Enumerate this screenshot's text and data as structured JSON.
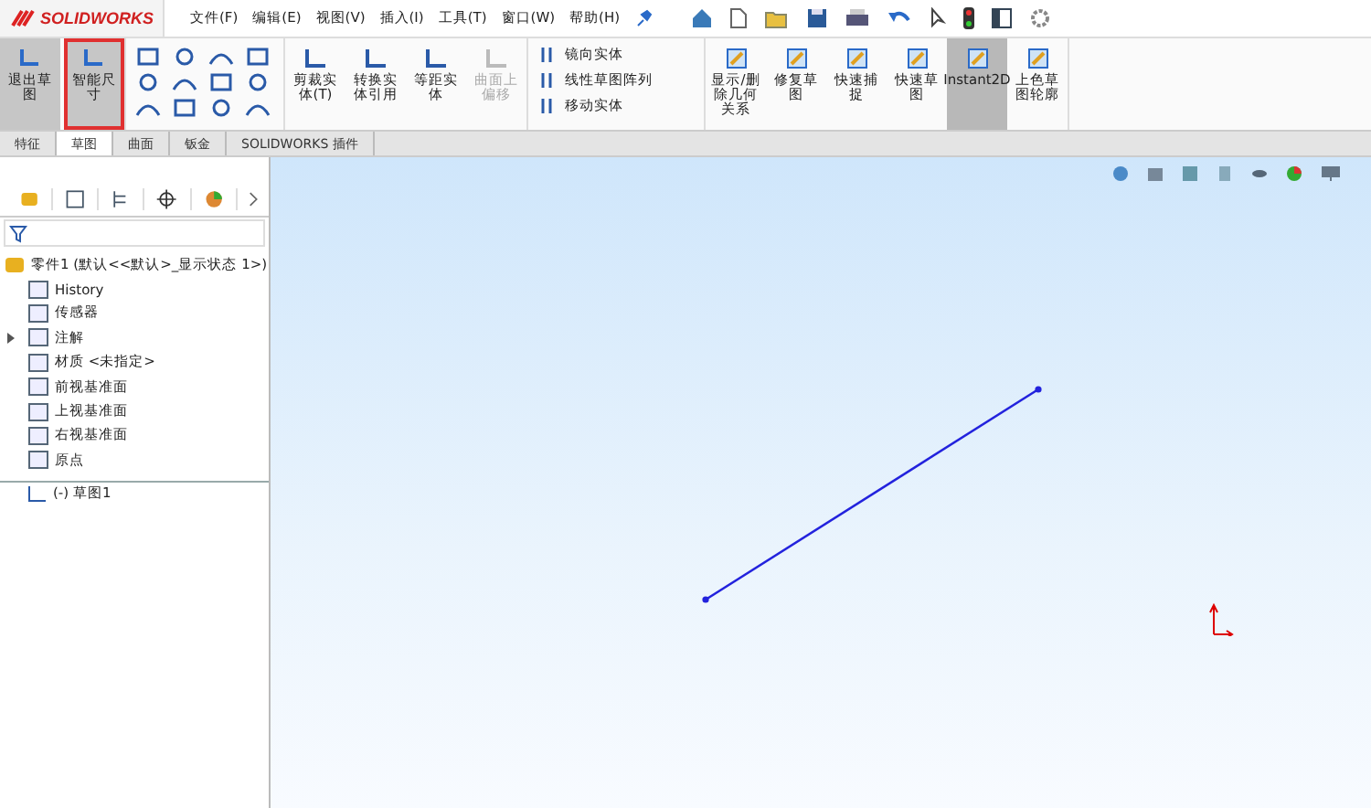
{
  "app": {
    "logo": "SOLIDWORKS"
  },
  "menu": [
    {
      "label": "文件(F)"
    },
    {
      "label": "编辑(E)"
    },
    {
      "label": "视图(V)"
    },
    {
      "label": "插入(I)"
    },
    {
      "label": "工具(T)"
    },
    {
      "label": "窗口(W)"
    },
    {
      "label": "帮助(H)"
    }
  ],
  "ribbon": {
    "main_buttons": [
      {
        "label": "退出草图",
        "highlighted": false
      },
      {
        "label": "智能尺寸",
        "highlighted": true
      }
    ],
    "tool_buttons": [
      {
        "label": "剪裁实体(T)",
        "disabled": false
      },
      {
        "label": "转换实体引用",
        "disabled": false
      },
      {
        "label": "等距实体",
        "disabled": false
      },
      {
        "label": "曲面上偏移",
        "disabled": true
      }
    ],
    "list_items": [
      {
        "label": "镜向实体"
      },
      {
        "label": "线性草图阵列"
      },
      {
        "label": "移动实体"
      }
    ],
    "right_buttons": [
      {
        "label": "显示/删除几何关系",
        "selected": false
      },
      {
        "label": "修复草图",
        "selected": false
      },
      {
        "label": "快速捕捉",
        "selected": false
      },
      {
        "label": "快速草图",
        "selected": false
      },
      {
        "label": "Instant2D",
        "selected": true
      },
      {
        "label": "上色草图轮廓",
        "selected": false
      }
    ]
  },
  "tabs": [
    {
      "label": "特征",
      "selected": false
    },
    {
      "label": "草图",
      "selected": true
    },
    {
      "label": "曲面",
      "selected": false
    },
    {
      "label": "钣金",
      "selected": false
    },
    {
      "label": "SOLIDWORKS 插件",
      "selected": false
    }
  ],
  "tree": {
    "root": "零件1 (默认<<默认>_显示状态 1>)",
    "items": [
      {
        "label": "History",
        "expandable": false
      },
      {
        "label": "传感器",
        "expandable": false
      },
      {
        "label": "注解",
        "expandable": true
      },
      {
        "label": "材质 <未指定>",
        "expandable": false
      },
      {
        "label": "前视基准面",
        "expandable": false
      },
      {
        "label": "上视基准面",
        "expandable": false
      },
      {
        "label": "右视基准面",
        "expandable": false
      },
      {
        "label": "原点",
        "expandable": false
      }
    ],
    "sketch": "(-) 草图1"
  }
}
